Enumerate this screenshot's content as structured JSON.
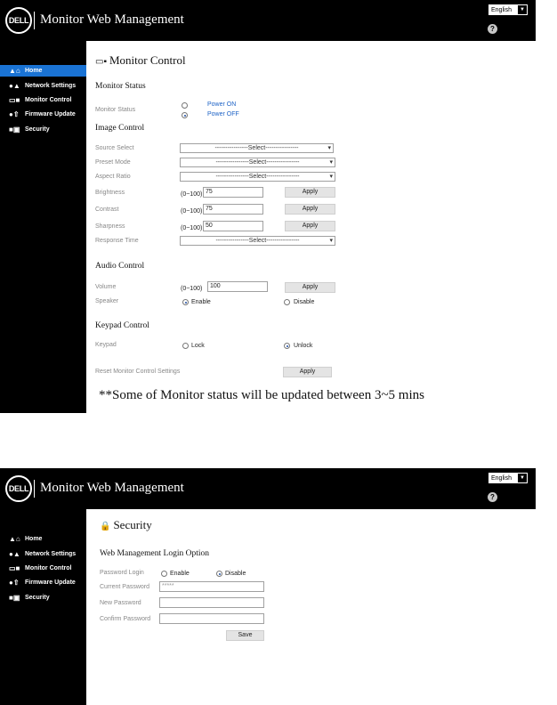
{
  "app": {
    "logo": "DELL",
    "title": "Monitor Web Management",
    "language": "English",
    "help": "?"
  },
  "nav": {
    "items": [
      {
        "label": "Home",
        "icon": "home-icon"
      },
      {
        "label": "Network Settings",
        "icon": "network-icon"
      },
      {
        "label": "Monitor Control",
        "icon": "monitor-icon"
      },
      {
        "label": "Firmware Update",
        "icon": "firmware-icon"
      },
      {
        "label": "Security",
        "icon": "lock-icon"
      }
    ]
  },
  "monitor_control": {
    "title": "Monitor Control",
    "status_section": "Monitor Status",
    "status_label": "Monitor Status",
    "power_on": "Power ON",
    "power_off": "Power OFF",
    "power_selected": "off",
    "image_section": "Image Control",
    "source_label": "Source Select",
    "preset_label": "Preset Mode",
    "aspect_label": "Aspect Ratio",
    "select_placeholder": "----------------Select----------------",
    "brightness_label": "Brightness",
    "contrast_label": "Contrast",
    "sharpness_label": "Sharpness",
    "response_label": "Response Time",
    "range": "(0~100)",
    "brightness_value": "75",
    "contrast_value": "75",
    "sharpness_value": "50",
    "apply": "Apply",
    "audio_section": "Audio Control",
    "volume_label": "Volume",
    "volume_value": "100",
    "speaker_label": "Speaker",
    "enable": "Enable",
    "disable": "Disable",
    "speaker_selected": "enable",
    "keypad_section": "Keypad Control",
    "keypad_label": "Keypad",
    "lock": "Lock",
    "unlock": "Unlock",
    "keypad_selected": "unlock",
    "reset_label": "Reset Monitor Control Settings",
    "note": "**Some of Monitor status will be updated between 3~5 mins"
  },
  "security": {
    "title": "Security",
    "section": "Web Management Login Option",
    "password_login_label": "Password Login",
    "enable": "Enable",
    "disable": "Disable",
    "login_selected": "disable",
    "current_password_label": "Current Password",
    "current_password_value": "*****",
    "new_password_label": "New Password",
    "confirm_password_label": "Confirm Password",
    "save": "Save"
  },
  "colors": {
    "header_bg": "#000000",
    "sidebar_bg": "#000000",
    "active_nav": "#1a73d4",
    "link_blue": "#1e63c6",
    "button_bg": "#e4e4e4"
  }
}
